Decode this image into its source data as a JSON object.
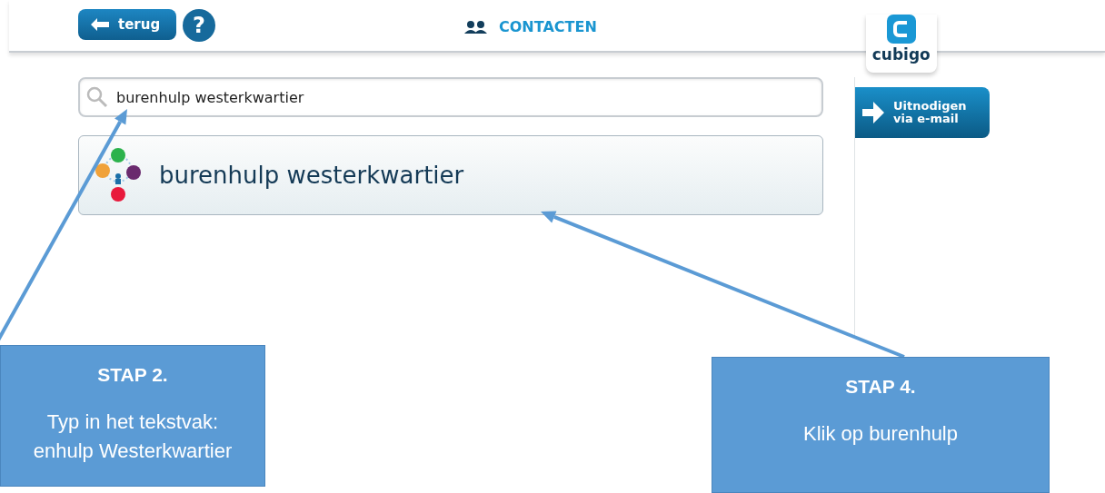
{
  "header": {
    "back_button": "terug",
    "help_button": "?",
    "title": "CONTACTEN",
    "logo": "cubigo"
  },
  "search": {
    "value": "burenhulp westerkwartier"
  },
  "results": [
    {
      "name": "burenhulp westerkwartier"
    }
  ],
  "invite_button": {
    "line1": "Uitnodigen",
    "line2": "via e-mail"
  },
  "callouts": [
    {
      "title": "STAP 2.",
      "lines": [
        "Typ in het tekstvak:",
        "enhulp Westerkwartier"
      ]
    },
    {
      "title": "STAP 4.",
      "lines": [
        "Klik op burenhulp"
      ]
    }
  ]
}
